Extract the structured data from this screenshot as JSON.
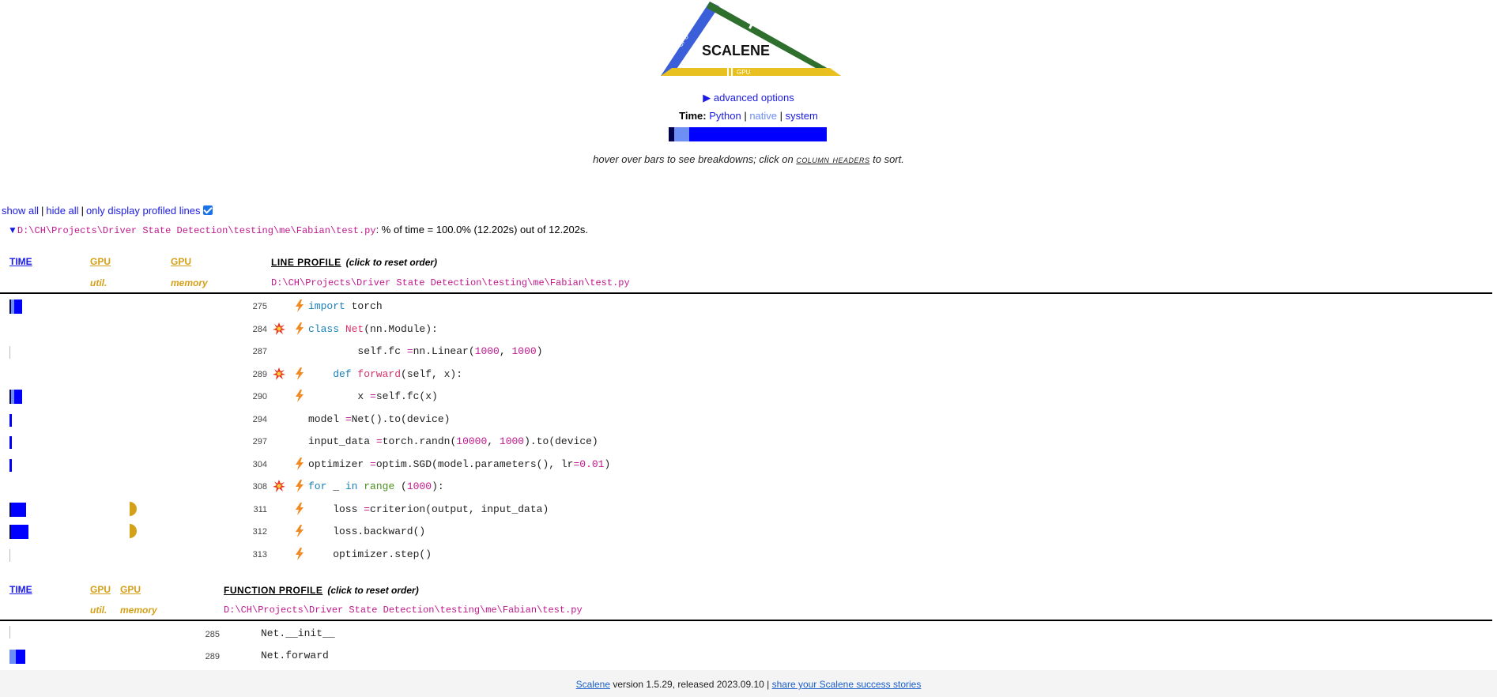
{
  "logo": {
    "title": "SCALENE",
    "cpu_label": "CPU",
    "memory_label": "MEMORY",
    "gpu_label": "GPU"
  },
  "advanced_options": "▶ advanced options",
  "timeline": {
    "label": "Time:",
    "python": "Python",
    "native": "native",
    "system": "system",
    "sep": "|"
  },
  "time_breakdown": {
    "system_fraction": 0.035,
    "native_fraction": 0.095,
    "python_fraction": 0.87
  },
  "hint": {
    "before": "hover over bars to see breakdowns; click on ",
    "link": "column headers",
    "after": " to sort."
  },
  "toggles": {
    "show_all": "show all",
    "hide_all": "hide all",
    "only_profiled": "only display profiled lines",
    "sep": "|"
  },
  "file": {
    "path": "D:\\CH\\Projects\\Driver State Detection\\testing\\me\\Fabian\\test.py",
    "summary": ": % of time = 100.0% (12.202s) out of 12.202s."
  },
  "line_profile": {
    "headers": {
      "time": "TIME",
      "gpu1": "GPU",
      "gpu2": "GPU",
      "title": "LINE PROFILE",
      "note": "(click to reset order)",
      "util": "util.",
      "memory": "memory"
    },
    "rows": [
      {
        "lineno": "275",
        "indent": 0,
        "code": [
          [
            "kw",
            "import"
          ],
          [
            "",
            "torch"
          ]
        ],
        "time": 0.1,
        "gpu_mem": 0,
        "bolt": true,
        "boom": false
      },
      {
        "lineno": "284",
        "indent": 0,
        "code": [
          [
            "kw",
            "class"
          ],
          [
            "fn",
            "Net"
          ],
          [
            "",
            "(nn.Module):"
          ]
        ],
        "time": 0,
        "gpu_mem": 0,
        "bolt": true,
        "boom": true
      },
      {
        "lineno": "287",
        "indent": 8,
        "code": [
          [
            "",
            "self.fc "
          ],
          [
            "op",
            "="
          ],
          [
            "",
            "nn.Linear("
          ],
          [
            "num",
            "1000"
          ],
          [
            "",
            ", "
          ],
          [
            "num",
            "1000"
          ],
          [
            "",
            ")"
          ]
        ],
        "time": 0.005,
        "gpu_mem": 0,
        "bolt": false,
        "boom": false
      },
      {
        "lineno": "289",
        "indent": 4,
        "code": [
          [
            "kw",
            "def"
          ],
          [
            "fn",
            "forward"
          ],
          [
            "",
            "(self, x):"
          ]
        ],
        "time": 0,
        "gpu_mem": 0,
        "bolt": true,
        "boom": true
      },
      {
        "lineno": "290",
        "indent": 8,
        "code": [
          [
            "",
            "x "
          ],
          [
            "op",
            "="
          ],
          [
            "",
            "self.fc(x)"
          ]
        ],
        "time": 0.1,
        "gpu_mem": 0,
        "bolt": true,
        "boom": false
      },
      {
        "lineno": "294",
        "indent": 0,
        "code": [
          [
            "",
            "model "
          ],
          [
            "op",
            "="
          ],
          [
            "",
            "Net().to(device)"
          ]
        ],
        "time": 0.01,
        "gpu_mem": 0,
        "bolt": false,
        "boom": false
      },
      {
        "lineno": "297",
        "indent": 0,
        "code": [
          [
            "",
            "input_data "
          ],
          [
            "op",
            "="
          ],
          [
            "",
            "torch.randn("
          ],
          [
            "num",
            "10000"
          ],
          [
            "",
            ", "
          ],
          [
            "num",
            "1000"
          ],
          [
            "",
            ").to(device)"
          ]
        ],
        "time": 0.01,
        "gpu_mem": 0,
        "bolt": false,
        "boom": false
      },
      {
        "lineno": "304",
        "indent": 0,
        "code": [
          [
            "",
            "optimizer "
          ],
          [
            "op",
            "="
          ],
          [
            "",
            "optim.SGD(model.parameters(), lr"
          ],
          [
            "op",
            "="
          ],
          [
            "num",
            "0.01"
          ],
          [
            "",
            ")"
          ]
        ],
        "time": 0.02,
        "gpu_mem": 0,
        "bolt": true,
        "boom": false
      },
      {
        "lineno": "308",
        "indent": 0,
        "code": [
          [
            "kw",
            "for"
          ],
          [
            "",
            "_ "
          ],
          [
            "kw",
            "in"
          ],
          [
            "bi",
            "range"
          ],
          [
            "",
            "("
          ],
          [
            "num",
            "1000"
          ],
          [
            "",
            "):"
          ]
        ],
        "time": 0,
        "gpu_mem": 0,
        "bolt": true,
        "boom": true
      },
      {
        "lineno": "311",
        "indent": 4,
        "code": [
          [
            "",
            "loss "
          ],
          [
            "op",
            "="
          ],
          [
            "",
            "criterion(output, input_data)"
          ]
        ],
        "time": 0.13,
        "gpu_mem": 0.5,
        "bolt": true,
        "boom": false
      },
      {
        "lineno": "312",
        "indent": 4,
        "code": [
          [
            "",
            "loss.backward()"
          ]
        ],
        "time": 0.15,
        "gpu_mem": 0.5,
        "bolt": true,
        "boom": false
      },
      {
        "lineno": "313",
        "indent": 4,
        "code": [
          [
            "",
            "optimizer.step()"
          ]
        ],
        "time": 0.005,
        "gpu_mem": 0,
        "bolt": true,
        "boom": false
      }
    ]
  },
  "function_profile": {
    "headers": {
      "time": "TIME",
      "gpu1": "GPU",
      "gpu2": "GPU",
      "title": "FUNCTION PROFILE",
      "note": "(click to reset order)",
      "util": "util.",
      "memory": "memory"
    },
    "rows": [
      {
        "lineno": "285",
        "name": "Net.__init__",
        "time": 0.005
      },
      {
        "lineno": "289",
        "name": "Net.forward",
        "time": 0.1
      }
    ]
  },
  "footer": {
    "scalene": "Scalene",
    "version": " version 1.5.29, released 2023.09.10  |  ",
    "share": "share your Scalene success stories"
  }
}
